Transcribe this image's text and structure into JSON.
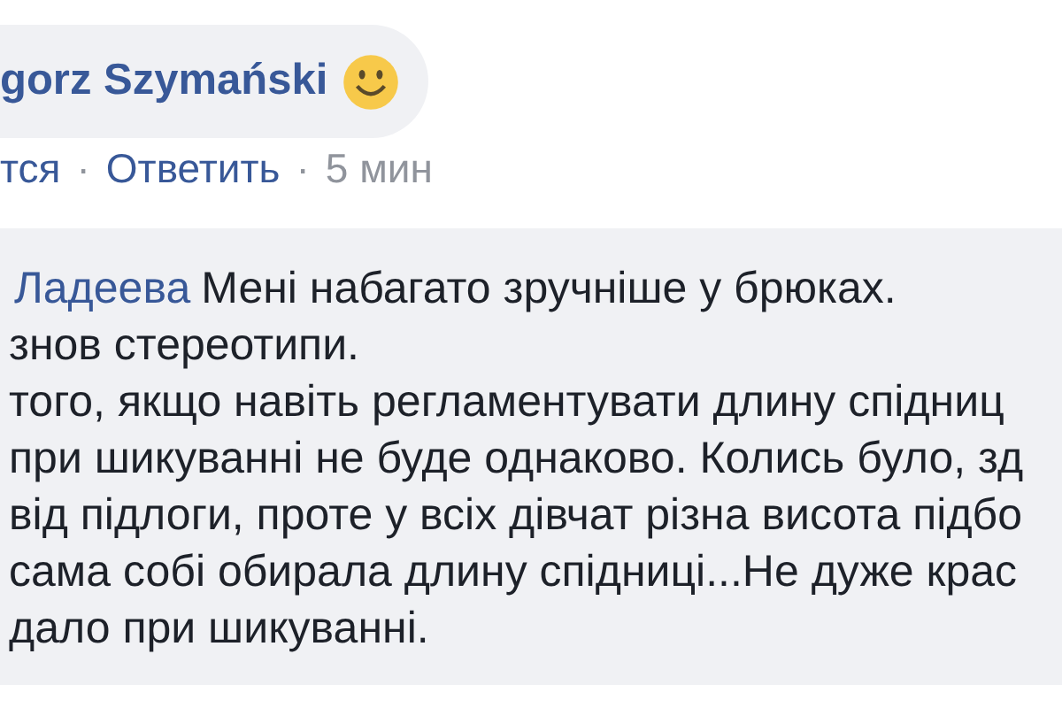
{
  "comments": [
    {
      "kind": "header",
      "author": "gorz Szymański",
      "actions": [
        {
          "text": "тся",
          "kind": "link"
        },
        {
          "text": "·",
          "kind": "separator"
        },
        {
          "text": "Ответить",
          "kind": "link"
        },
        {
          "text": "·",
          "kind": "separator"
        },
        {
          "text": "5 мин",
          "kind": "time"
        }
      ]
    },
    {
      "kind": "comment",
      "author": "Ладеева",
      "lines": [
        "Мені набагато зручніше у брюках.",
        "знов стереотипи.",
        "того, якщо навіть регламентувати длину спідниц",
        "при шикуванні не буде однаково. Колись було, зд",
        "від підлоги, проте у всіх дівчат різна висота підбо",
        "сама собі обирала длину спідниці...Не дуже крас",
        "дало при шикуванні."
      ]
    }
  ]
}
